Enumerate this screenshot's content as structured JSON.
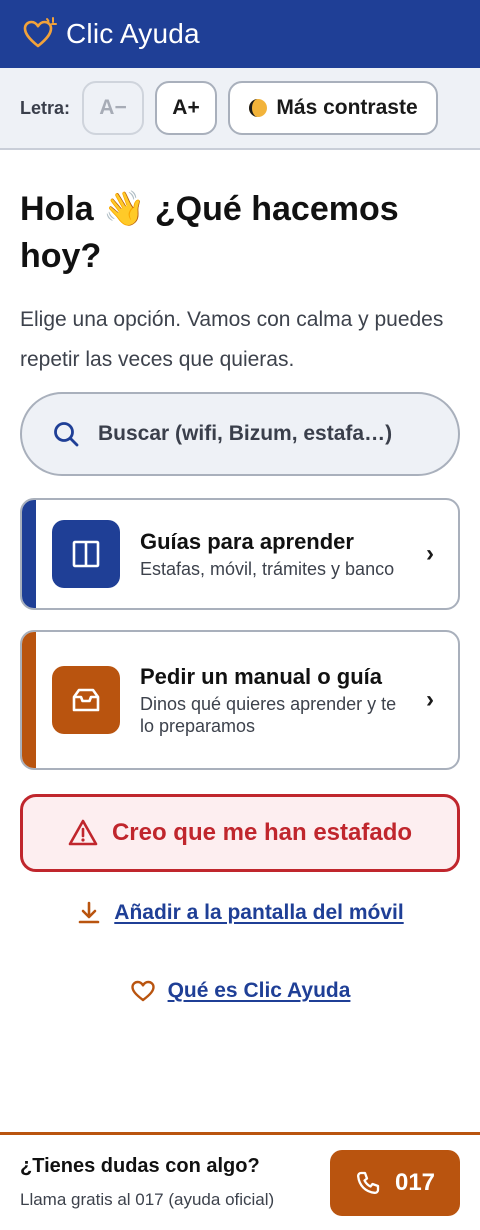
{
  "header": {
    "title": "Clic Ayuda",
    "icon": "heart-sparkle-icon"
  },
  "toolbar": {
    "text_size_label": "Letra:",
    "decrease_label": "A−",
    "increase_label": "A+",
    "contrast_label": "Más contraste",
    "contrast_icon": "half-moon-icon"
  },
  "main": {
    "greeting": "Hola 👋 ¿Qué hacemos hoy?",
    "subtitle": "Elige una opción. Vamos con calma y puedes repetir las veces que quieras.",
    "search_placeholder": "Buscar (wifi, Bizum, estafa…)",
    "cards": [
      {
        "title": "Guías para aprender",
        "description": "Estafas, móvil, trámites y banco",
        "icon": "book-icon",
        "accent": "#1f3f96"
      },
      {
        "title": "Pedir un manual o guía",
        "description": "Dinos qué quieres aprender y te lo preparamos",
        "icon": "inbox-icon",
        "accent": "#b9540f"
      }
    ],
    "scam_button": "Creo que me han estafado",
    "install_link": "Añadir a la pantalla del móvil",
    "about_link": "Qué es Clic Ayuda"
  },
  "footer": {
    "question": "¿Tienes dudas con algo?",
    "subtext": "Llama gratis al 017 (ayuda oficial)",
    "call_label": "017"
  },
  "colors": {
    "primary": "#1f3f96",
    "accent": "#b9540f",
    "danger": "#c0262d",
    "toolbar_bg": "#eef1f6"
  }
}
